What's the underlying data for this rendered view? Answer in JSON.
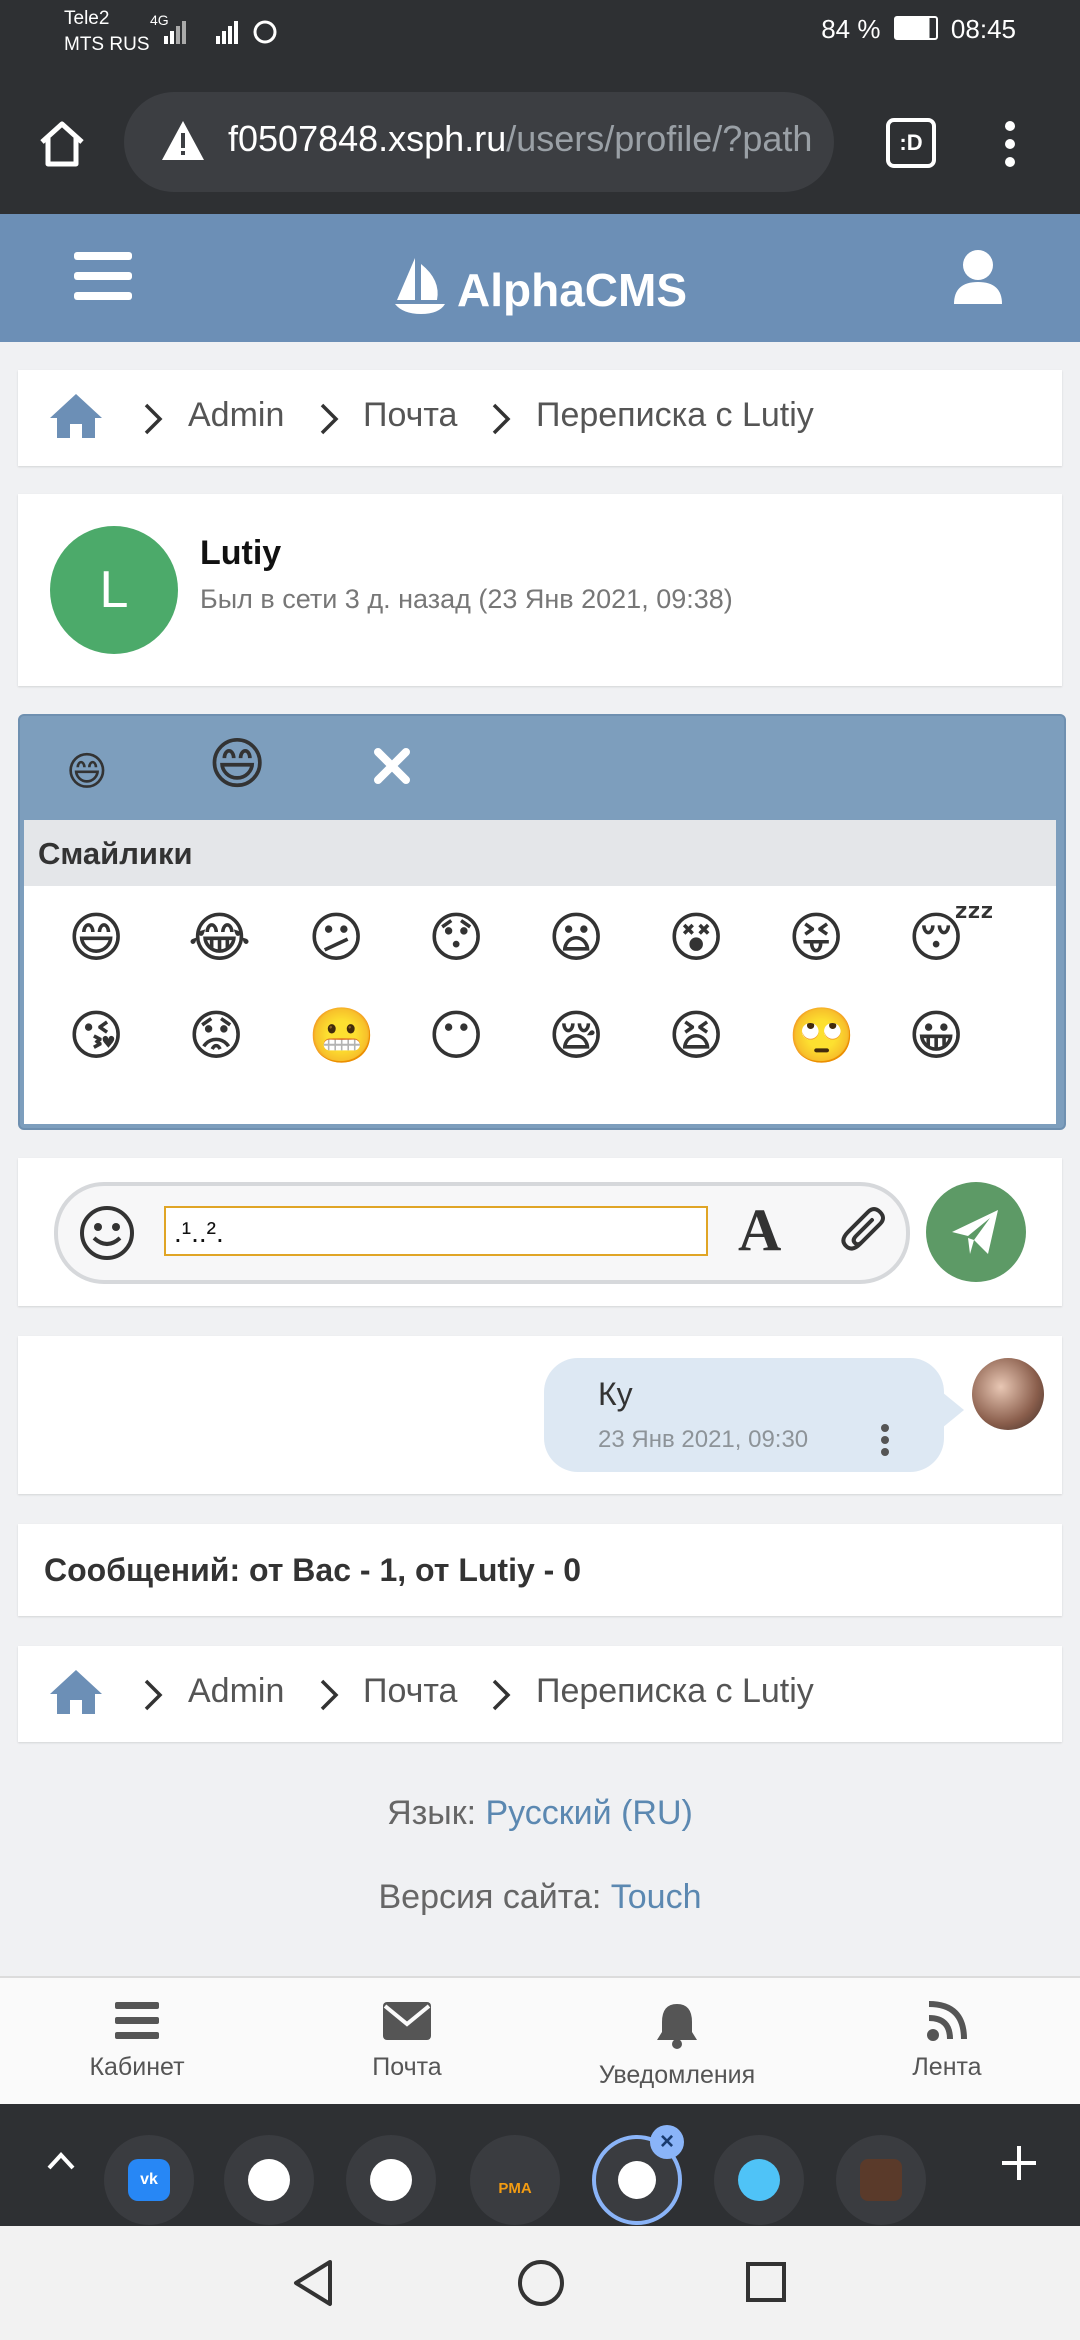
{
  "status_bar": {
    "carrier1": "Tele2",
    "carrier2": "MTS RUS",
    "net1": "4G",
    "battery": "84 %",
    "time": "08:45"
  },
  "browser": {
    "url_domain": "f0507848.xsph.ru",
    "url_path": "/users/profile/?path",
    "tabs_label": ":D"
  },
  "header": {
    "brand": "AlphaCMS"
  },
  "breadcrumb": {
    "admin": "Admin",
    "mail": "Почта",
    "current": "Переписка с Lutiy"
  },
  "contact": {
    "avatar_letter": "L",
    "name": "Lutiy",
    "status": "Был в сети 3 д. назад (23 Янв 2021, 09:38)"
  },
  "smiley_panel": {
    "title": "Смайлики",
    "tabs": [
      "😄",
      "😄"
    ],
    "row1": [
      "😄",
      "😂",
      "😕",
      "😯",
      "😦",
      "😵",
      "😝",
      "😴"
    ],
    "row2": [
      "😘",
      "😟",
      "😬",
      "😶",
      "😪",
      "😫",
      "🙄",
      "😀"
    ]
  },
  "composer": {
    "value": ".¹..².",
    "font_glyph": "A"
  },
  "message": {
    "text": "Ку",
    "time": "23 Янв 2021, 09:30"
  },
  "counts": {
    "text": "Сообщений: от Вас - 1, от Lutiy - 0"
  },
  "footer": {
    "lang_label": "Язык:",
    "lang_value": "Русский (RU)",
    "version_label": "Версия сайта:",
    "version_value": "Touch"
  },
  "bottom_nav": {
    "cabinet": "Кабинет",
    "mail": "Почта",
    "notifications": "Уведомления",
    "feed": "Лента"
  },
  "tabstrip": {
    "app_pma": "PMA"
  },
  "colors": {
    "header": "#6c8fb6",
    "link": "#5b88b1",
    "avatar": "#4caa6a",
    "send": "#5d9a66",
    "bubble": "#dde8f3"
  }
}
